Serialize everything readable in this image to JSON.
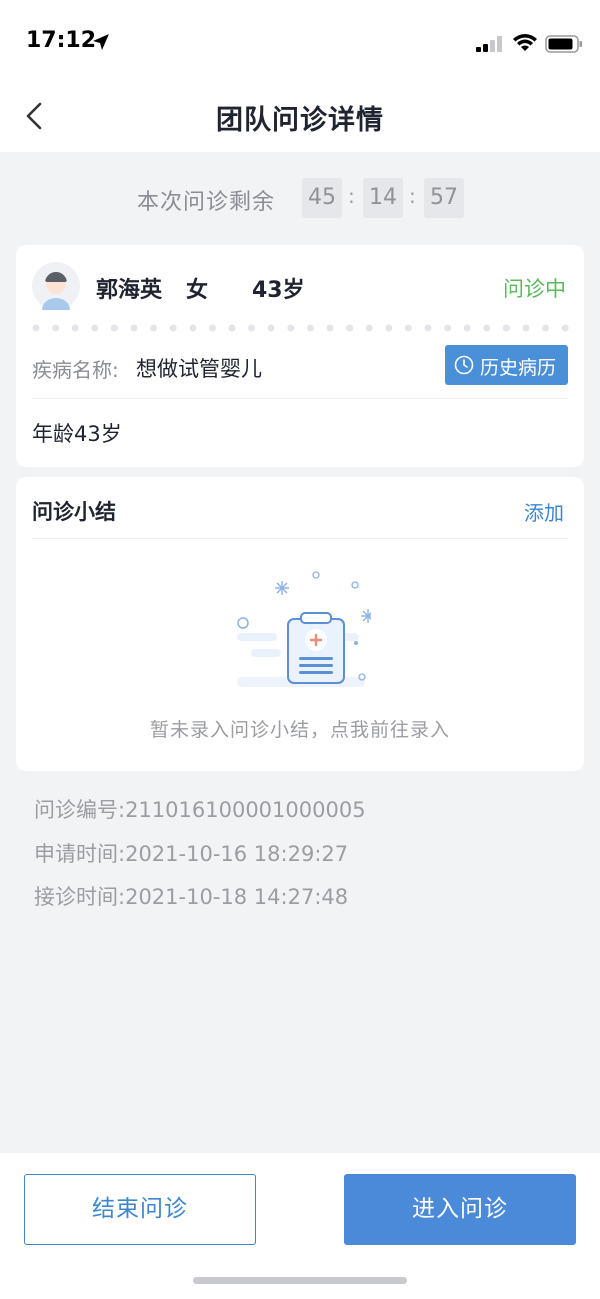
{
  "status_bar": {
    "time": "17:12"
  },
  "header": {
    "title": "团队问诊详情"
  },
  "countdown": {
    "label": "本次问诊剩余",
    "hours": "45",
    "minutes": "14",
    "seconds": "57",
    "separator": ":"
  },
  "patient": {
    "name": "郭海英",
    "sex": "女",
    "age": "43岁",
    "status": "问诊中",
    "disease_label": "疾病名称:",
    "disease_value": "想做试管婴儿",
    "history_button": "历史病历",
    "age_text": "年龄43岁"
  },
  "summary": {
    "title": "问诊小结",
    "add_label": "添加",
    "empty_text": "暂未录入问诊小结，点我前往录入"
  },
  "info": {
    "consult_no_label": "问诊编号:",
    "consult_no_value": "211016100001000005",
    "apply_time_label": "申请时间:",
    "apply_time_value": "2021-10-16 18:29:27",
    "accept_time_label": "接诊时间:",
    "accept_time_value": "2021-10-18 14:27:48"
  },
  "footer": {
    "end_button": "结束问诊",
    "enter_button": "进入问诊"
  },
  "colors": {
    "accent": "#4a8ad8",
    "status_green": "#5cb85c",
    "link_blue": "#3d86d1"
  }
}
